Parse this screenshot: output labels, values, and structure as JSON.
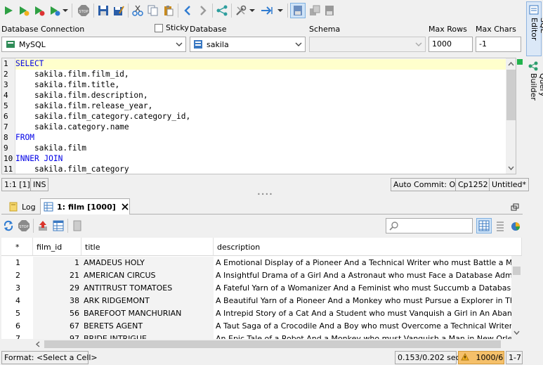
{
  "connection_bar": {
    "database_connection_label": "Database Connection",
    "sticky_label": "Sticky",
    "database_label": "Database",
    "schema_label": "Schema",
    "max_rows_label": "Max Rows",
    "max_chars_label": "Max Chars",
    "connection_value": "MySQL",
    "database_value": "sakila",
    "schema_value": "",
    "max_rows_value": "1000",
    "max_chars_value": "-1"
  },
  "side_tabs": {
    "sql_editor": "SQL Editor",
    "query_builder": "Query Builder"
  },
  "editor": {
    "lines": [
      {
        "num": "1",
        "text": "SELECT",
        "keyword": true
      },
      {
        "num": "2",
        "text": "    sakila.film.film_id,",
        "keyword": false
      },
      {
        "num": "3",
        "text": "    sakila.film.title,",
        "keyword": false
      },
      {
        "num": "4",
        "text": "    sakila.film.description,",
        "keyword": false
      },
      {
        "num": "5",
        "text": "    sakila.film.release_year,",
        "keyword": false
      },
      {
        "num": "6",
        "text": "    sakila.film_category.category_id,",
        "keyword": false
      },
      {
        "num": "7",
        "text": "    sakila.category.name",
        "keyword": false
      },
      {
        "num": "8",
        "text": "FROM",
        "keyword": true
      },
      {
        "num": "9",
        "text": "    sakila.film",
        "keyword": false
      },
      {
        "num": "10",
        "text": "INNER JOIN",
        "keyword": true
      },
      {
        "num": "11",
        "text": "    sakila.film_category",
        "keyword": false
      }
    ]
  },
  "editor_status": {
    "position": "1:1 [1]",
    "mode": "INS",
    "auto_commit": "Auto Commit: ON",
    "encoding": "Cp1252",
    "doc_name": "Untitled*"
  },
  "result_tabs": {
    "log": "Log",
    "film": "1: film [1000]"
  },
  "grid": {
    "columns": [
      "*",
      "film_id",
      "title",
      "description"
    ],
    "rows": [
      {
        "n": "1",
        "film_id": "1",
        "title": "AMADEUS HOLY",
        "description": "A Emotional Display of a Pioneer And a Technical Writer who must Battle a Man in A Balo"
      },
      {
        "n": "2",
        "film_id": "21",
        "title": "AMERICAN CIRCUS",
        "description": "A Insightful Drama of a Girl And a Astronaut who must Face a Database Administrator in"
      },
      {
        "n": "3",
        "film_id": "29",
        "title": "ANTITRUST TOMATOES",
        "description": "A Fateful Yarn of a Womanizer And a Feminist who must Succumb a Database Administra"
      },
      {
        "n": "4",
        "film_id": "38",
        "title": "ARK RIDGEMONT",
        "description": "A Beautiful Yarn of a Pioneer And a Monkey who must Pursue a Explorer in The Sahara D"
      },
      {
        "n": "5",
        "film_id": "56",
        "title": "BAREFOOT MANCHURIAN",
        "description": "A Intrepid Story of a Cat And a Student who must Vanquish a Girl in An Abandoned Amu"
      },
      {
        "n": "6",
        "film_id": "67",
        "title": "BERETS AGENT",
        "description": "A Taut Saga of a Crocodile And a Boy who must Overcome a Technical Writer in Ancient"
      },
      {
        "n": "7",
        "film_id": "97",
        "title": "BRIDE INTRIGUE",
        "description": "An Epic Tale of a Robot And a Monkey who must Vanquish a Man in New Orleans"
      }
    ]
  },
  "bottom_status": {
    "format_label": "Format:",
    "format_value": "<Select a Cell>",
    "timing": "0.153/0.202 sec",
    "rows": "1000/6",
    "cols": "1-7"
  },
  "colors": {
    "keyword": "#0000e6",
    "current_line": "#ffffcc",
    "selected_tab": "#d9e9f9",
    "warning": "#f5c06a"
  }
}
